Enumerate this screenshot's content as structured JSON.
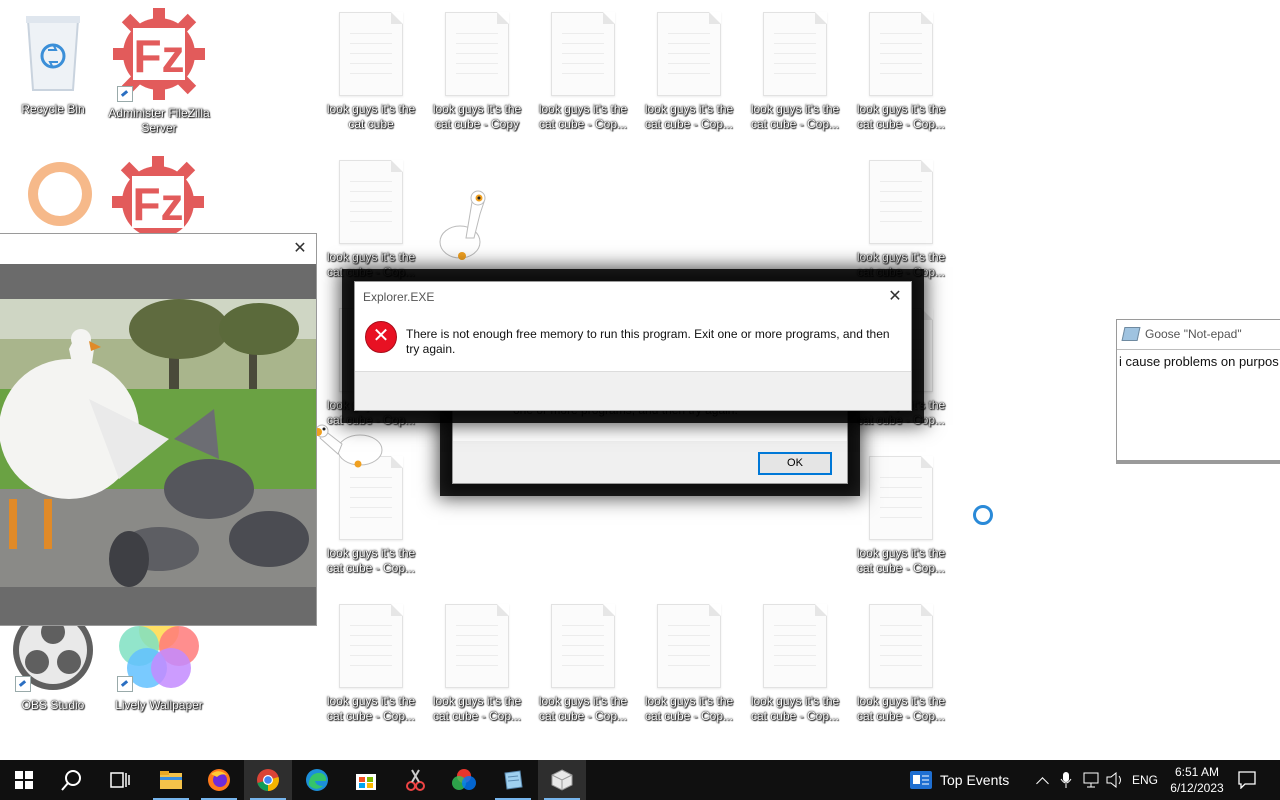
{
  "desktop": {
    "icons": {
      "recycle_bin": "Recycle Bin",
      "filezilla_server": "Administer FileZilla Server",
      "obs_studio": "OBS Studio",
      "lively_wallpaper": "Lively Wallpaper",
      "cat_cube": "look guys it's the cat cube",
      "cat_cube_copy": "look guys it's the cat cube - Copy",
      "cat_cube_copy_trunc": "look guys it's the cat cube - Cop..."
    }
  },
  "dialog_front": {
    "title": "Explorer.EXE",
    "message": "There is not enough free memory to run this program. Exit one or more programs, and then try again."
  },
  "dialog_back": {
    "message_fragment": "one or more programs, and then try again.",
    "ok_label": "OK"
  },
  "notepad": {
    "title": "Goose \"Not-epad\"",
    "text": "i cause problems on purpos"
  },
  "taskbar": {
    "widget_label": "Top Events",
    "language": "ENG",
    "time": "6:51 AM",
    "date": "6/12/2023"
  },
  "colors": {
    "error_red": "#e81123",
    "accent_blue": "#0078d7",
    "taskbar_bg": "#101010"
  },
  "icon_names": [
    "windows-start-icon",
    "search-icon",
    "task-view-icon",
    "file-explorer-icon",
    "firefox-icon",
    "chrome-icon",
    "edge-icon",
    "store-icon",
    "tool-icon",
    "color-wheel-icon",
    "notepad-icon",
    "cube-icon"
  ]
}
